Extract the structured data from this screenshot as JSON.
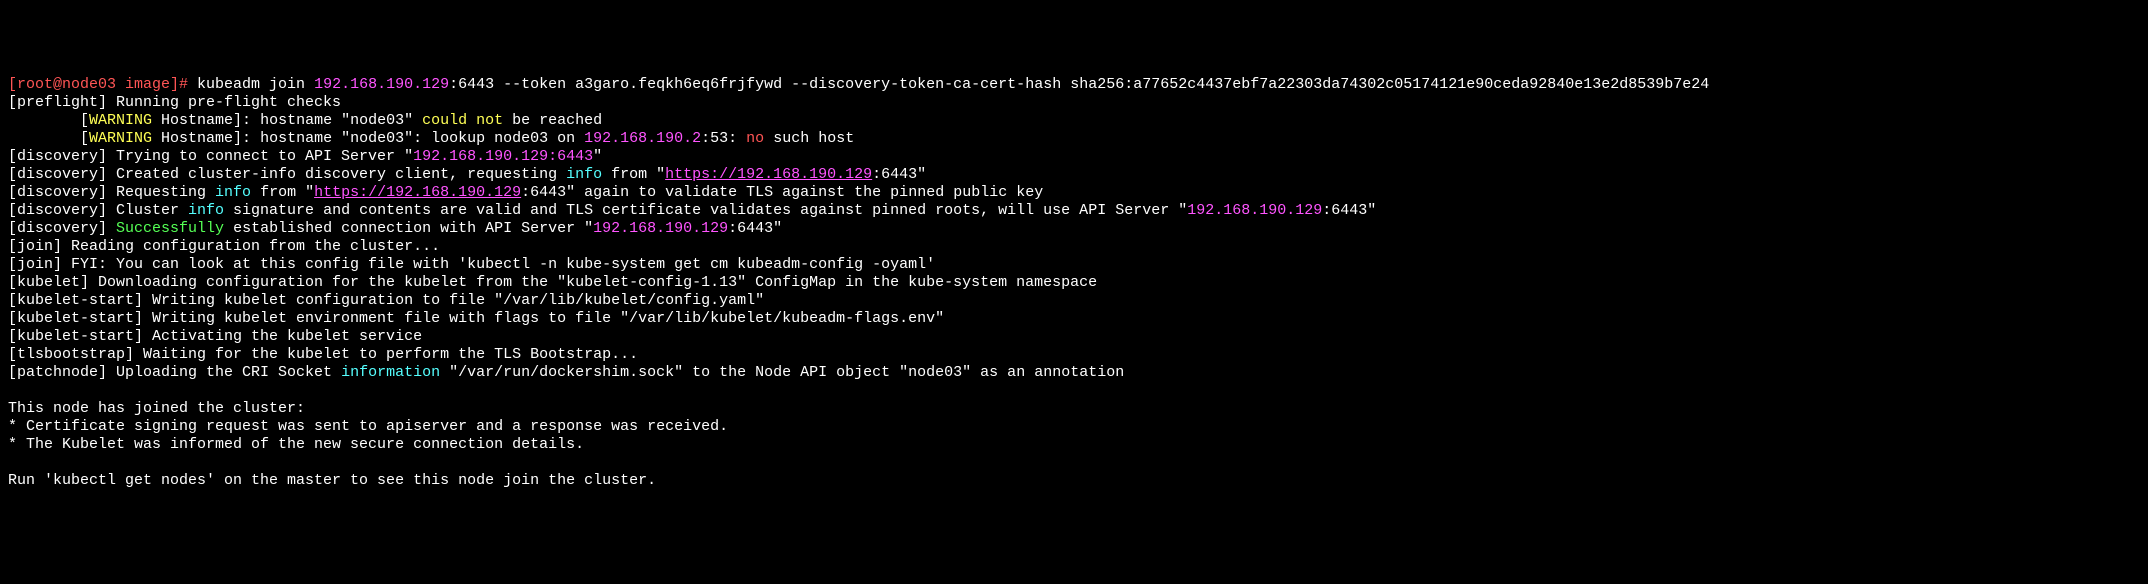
{
  "prompt": {
    "user_host": "[root@node03 image]# ",
    "cmd1": "kubeadm join ",
    "ip_port": "192.168.190.129",
    "cmd2": ":6443 --token a3garo.feqkh6eq6frjfywd --discovery-token-ca-cert-hash sha256:a77652c4437ebf7a22303da74302c05174121e90ceda92840e13e2d8539b7e24"
  },
  "lines": {
    "preflight": "[preflight] Running pre-flight checks",
    "warn1a": "        [",
    "warn1b": "WARNING",
    "warn1c": " Hostname]: hostname \"node03\" ",
    "warn1d": "could not",
    "warn1e": " be reached",
    "warn2a": "        [",
    "warn2b": "WARNING",
    "warn2c": " Hostname]: hostname \"node03\": lookup node03 on ",
    "warn2d": "192.168.190.2",
    "warn2e": ":53: ",
    "warn2f": "no",
    "warn2g": " such host",
    "disc1a": "[discovery] Trying to connect to API Server \"",
    "disc1b": "192.168.190.129:6443",
    "disc1c": "\"",
    "disc2a": "[discovery] Created cluster-info discovery client, requesting ",
    "disc2b": "info",
    "disc2c": " from \"",
    "disc2d": "https://192.168.190.129",
    "disc2e": ":6443\"",
    "disc3a": "[discovery] Requesting ",
    "disc3b": "info",
    "disc3c": " from \"",
    "disc3d": "https://192.168.190.129",
    "disc3e": ":6443\" again to validate TLS against the pinned public key",
    "disc4a": "[discovery] Cluster ",
    "disc4b": "info",
    "disc4c": " signature and contents are valid and TLS certificate validates against pinned roots, will use API Server \"",
    "disc4d": "192.168.190.129",
    "disc4e": ":6443\"",
    "disc5a": "[discovery] ",
    "disc5b": "Successfully",
    "disc5c": " established connection with API Server \"",
    "disc5d": "192.168.190.129",
    "disc5e": ":6443\"",
    "join1": "[join] Reading configuration from the cluster...",
    "join2": "[join] FYI: You can look at this config file with 'kubectl -n kube-system get cm kubeadm-config -oyaml'",
    "kubelet1": "[kubelet] Downloading configuration for the kubelet from the \"kubelet-config-1.13\" ConfigMap in the kube-system namespace",
    "kstart1": "[kubelet-start] Writing kubelet configuration to file \"/var/lib/kubelet/config.yaml\"",
    "kstart2": "[kubelet-start] Writing kubelet environment file with flags to file \"/var/lib/kubelet/kubeadm-flags.env\"",
    "kstart3": "[kubelet-start] Activating the kubelet service",
    "tls": "[tlsbootstrap] Waiting for the kubelet to perform the TLS Bootstrap...",
    "patch1a": "[patchnode] Uploading the CRI Socket ",
    "patch1b": "information",
    "patch1c": " \"/var/run/dockershim.sock\" to the Node API object \"node03\" as an annotation",
    "blank": "",
    "joined": "This node has joined the cluster:",
    "cert": "* Certificate signing request was sent to apiserver and a response was received.",
    "kube": "* The Kubelet was informed of the new secure connection details.",
    "run": "Run 'kubectl get nodes' on the master to see this node join the cluster."
  }
}
